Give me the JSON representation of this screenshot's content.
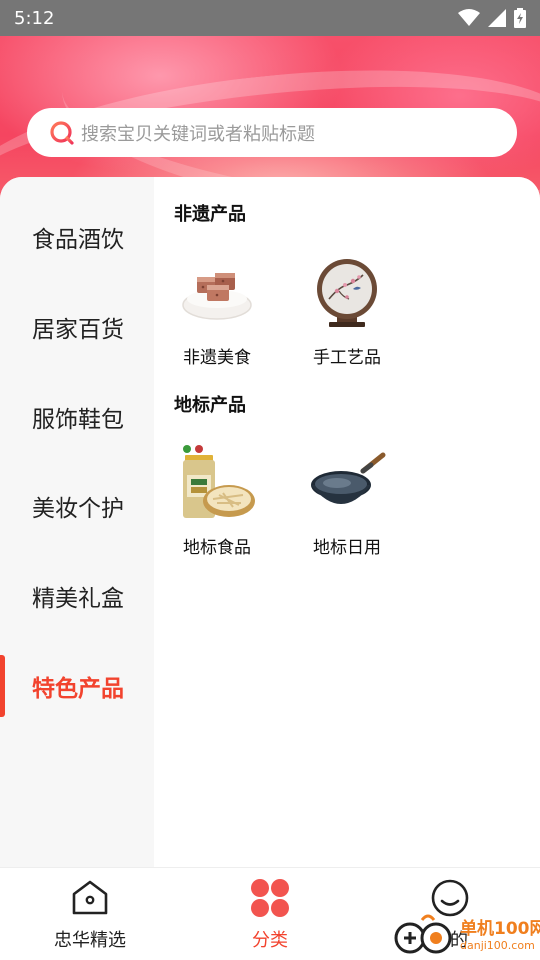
{
  "status_bar": {
    "time": "5:12"
  },
  "search": {
    "placeholder": "搜索宝贝关键词或者粘贴标题"
  },
  "sidebar": {
    "items": [
      {
        "label": "食品酒饮"
      },
      {
        "label": "居家百货"
      },
      {
        "label": "服饰鞋包"
      },
      {
        "label": "美妆个护"
      },
      {
        "label": "精美礼盒"
      },
      {
        "label": "特色产品"
      }
    ],
    "active": "特色产品"
  },
  "content": {
    "sections": [
      {
        "title": "非遗产品",
        "products": [
          {
            "label": "非遗美食",
            "icon": "food-dish-image"
          },
          {
            "label": "手工艺品",
            "icon": "embroidery-screen-image"
          }
        ]
      },
      {
        "title": "地标产品",
        "products": [
          {
            "label": "地标食品",
            "icon": "jar-snack-image"
          },
          {
            "label": "地标日用",
            "icon": "wok-pan-image"
          }
        ]
      }
    ]
  },
  "bottom_nav": {
    "items": [
      {
        "label": "忠华精选",
        "icon": "home-icon"
      },
      {
        "label": "分类",
        "icon": "category-grid-icon"
      },
      {
        "label": "我的",
        "icon": "smile-face-icon"
      }
    ],
    "active": "分类"
  },
  "watermark": {
    "line1": "单机100网",
    "line2": "danji100.com"
  },
  "colors": {
    "accent": "#f2432e",
    "header": "#f54560",
    "sidebar_bg": "#f7f7f7"
  }
}
